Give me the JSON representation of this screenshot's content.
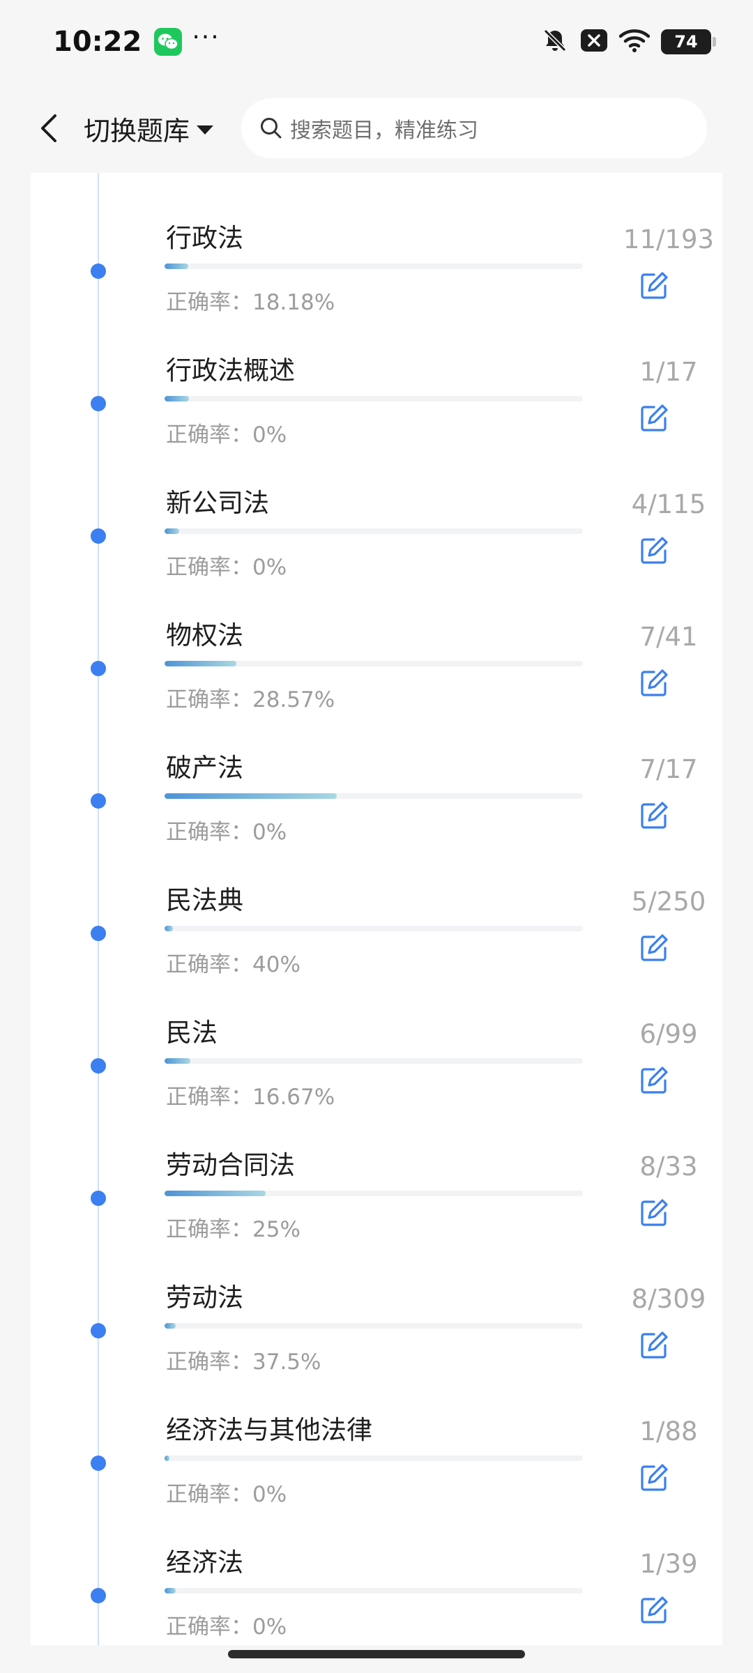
{
  "status_bar": {
    "time": "10:22",
    "dots": "···",
    "battery": "74"
  },
  "top_bar": {
    "bank_switch_label": "切换题库",
    "search_placeholder": "搜索题目，精准练习"
  },
  "colors": {
    "accent": "#3b7ff0",
    "wechat_green": "#1fc85c"
  },
  "items": [
    {
      "title": "行政法",
      "accuracy": "正确率：18.18%",
      "count": "11/193",
      "progress": 0.057
    },
    {
      "title": "行政法概述",
      "accuracy": "正确率：0%",
      "count": "1/17",
      "progress": 0.059
    },
    {
      "title": "新公司法",
      "accuracy": "正确率：0%",
      "count": "4/115",
      "progress": 0.035
    },
    {
      "title": "物权法",
      "accuracy": "正确率：28.57%",
      "count": "7/41",
      "progress": 0.171
    },
    {
      "title": "破产法",
      "accuracy": "正确率：0%",
      "count": "7/17",
      "progress": 0.412
    },
    {
      "title": "民法典",
      "accuracy": "正确率：40%",
      "count": "5/250",
      "progress": 0.02
    },
    {
      "title": "民法",
      "accuracy": "正确率：16.67%",
      "count": "6/99",
      "progress": 0.061
    },
    {
      "title": "劳动合同法",
      "accuracy": "正确率：25%",
      "count": "8/33",
      "progress": 0.242
    },
    {
      "title": "劳动法",
      "accuracy": "正确率：37.5%",
      "count": "8/309",
      "progress": 0.026
    },
    {
      "title": "经济法与其他法律",
      "accuracy": "正确率：0%",
      "count": "1/88",
      "progress": 0.011
    },
    {
      "title": "经济法",
      "accuracy": "正确率：0%",
      "count": "1/39",
      "progress": 0.026
    }
  ]
}
